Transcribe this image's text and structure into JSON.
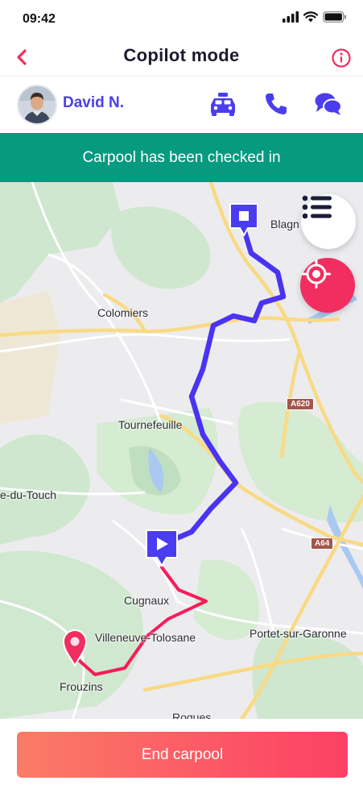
{
  "status_bar": {
    "time": "09:42",
    "icons": [
      "signal-icon",
      "wifi-icon",
      "battery-icon"
    ]
  },
  "header": {
    "title": "Copilot mode",
    "back_icon": "chevron-left-icon",
    "info_icon": "info-icon"
  },
  "driver": {
    "name": "David N.",
    "actions": [
      "car-icon",
      "phone-icon",
      "chat-icon"
    ]
  },
  "banner": {
    "text": "Carpool has been checked in"
  },
  "map": {
    "places": {
      "blagnac": "Blagn",
      "colomiers": "Colomiers",
      "tournefeuille": "Tournefeuille",
      "touch": "e-du-Touch",
      "cugnaux": "Cugnaux",
      "villeneuve": "Villeneuve-Tolosane",
      "portet": "Portet-sur-Garonne",
      "frouzins": "Frouzins",
      "roques": "Roques"
    },
    "road_shields": {
      "a620": "A620",
      "a64": "A64"
    },
    "buttons": [
      "list-icon",
      "locate-icon"
    ]
  },
  "footer": {
    "end_label": "End carpool"
  },
  "colors": {
    "accent": "#4a3df0",
    "banner": "#069a80",
    "danger": "#f22d5f",
    "route_driven": "#fa1a5a",
    "route_planned": "#4a33f2"
  }
}
